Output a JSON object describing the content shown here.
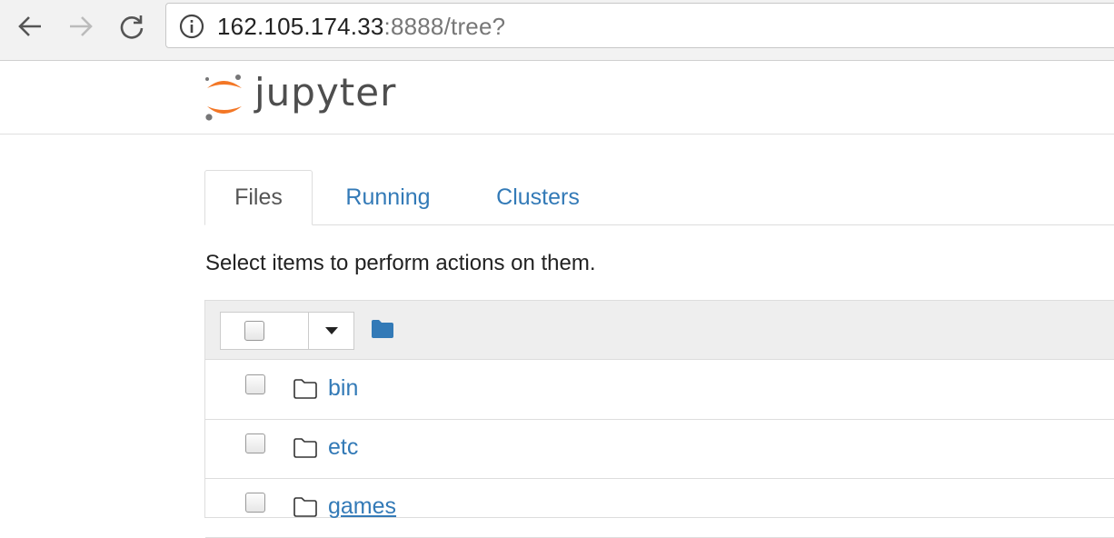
{
  "browser": {
    "url_host": "162.105.174.33",
    "url_rest": ":8888/tree?"
  },
  "header": {
    "logo_text": "jupyter"
  },
  "tabs": [
    {
      "label": "Files",
      "active": true
    },
    {
      "label": "Running",
      "active": false
    },
    {
      "label": "Clusters",
      "active": false
    }
  ],
  "hint": "Select items to perform actions on them.",
  "colors": {
    "link": "#337ab7",
    "folder_blue": "#337ab7",
    "logo_orange": "#f37726"
  },
  "files": [
    {
      "name": "bin",
      "type": "folder"
    },
    {
      "name": "etc",
      "type": "folder"
    },
    {
      "name": "games",
      "type": "folder"
    }
  ]
}
